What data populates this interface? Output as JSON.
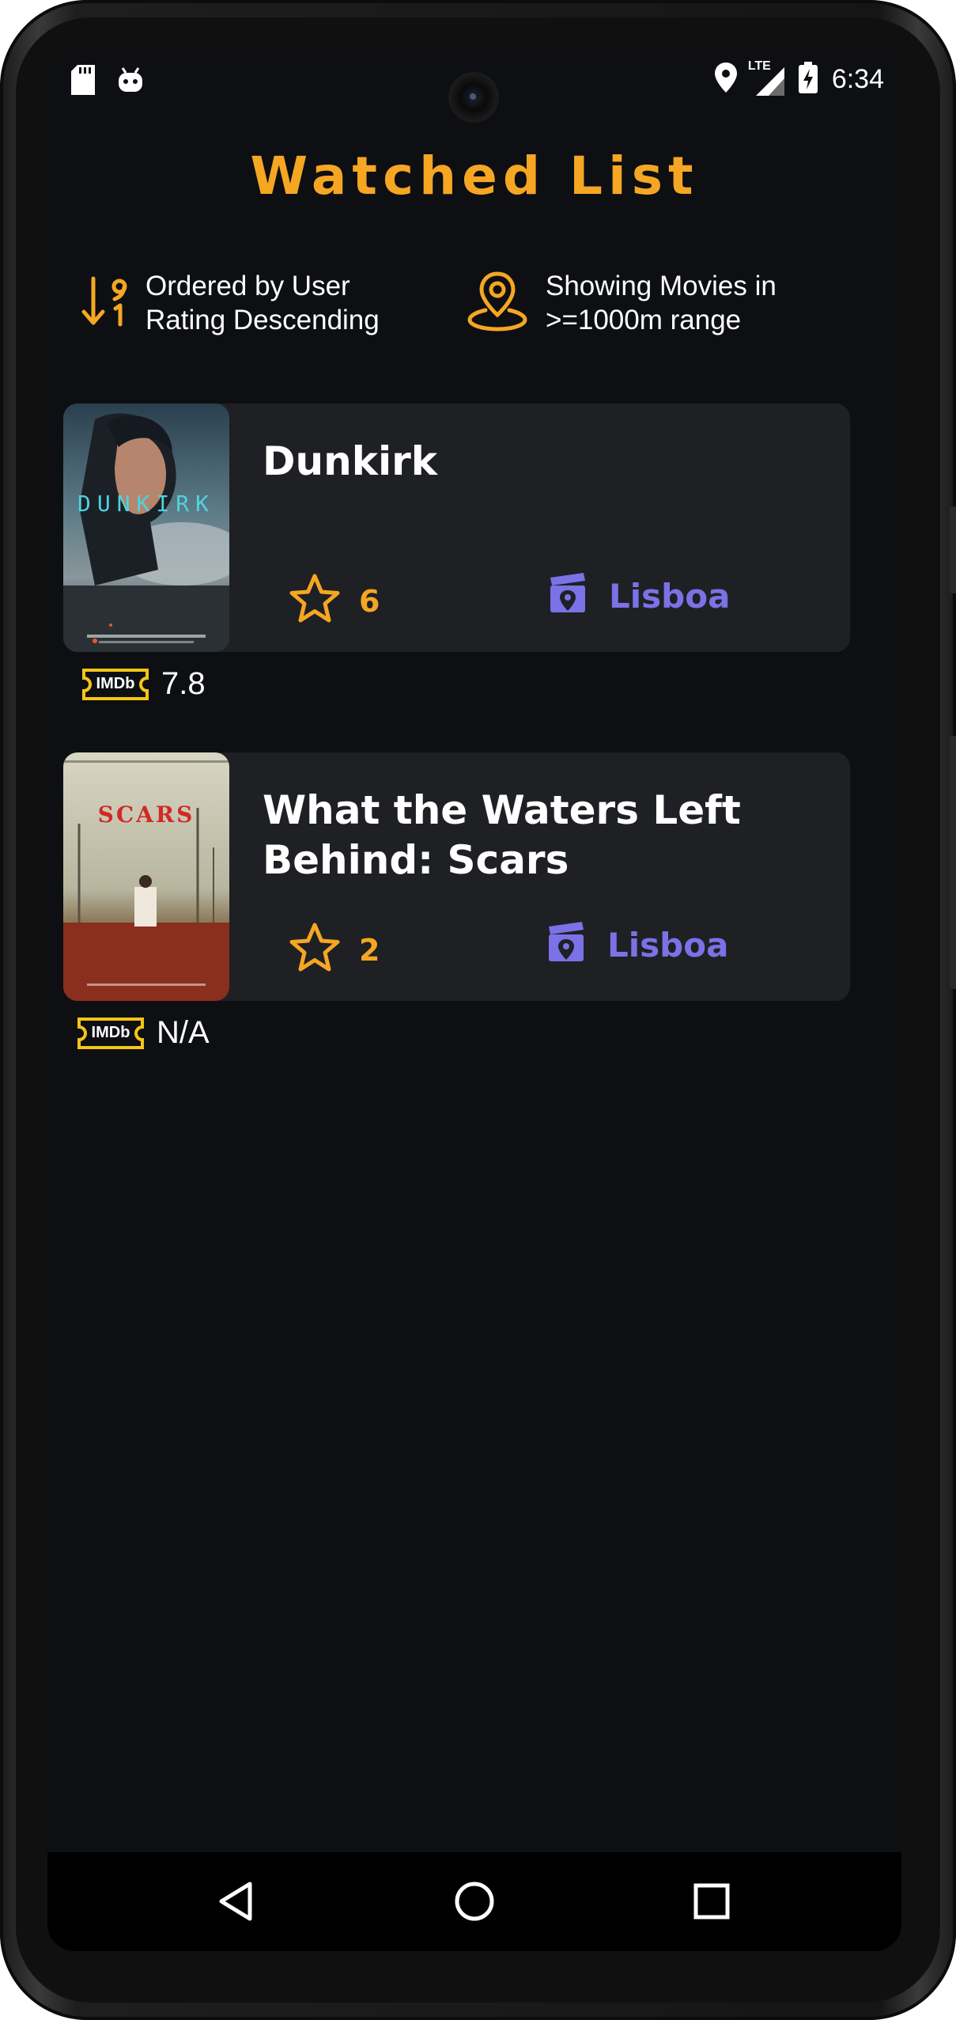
{
  "status_bar": {
    "time": "6:34",
    "icons": [
      "sd-card-icon",
      "android-icon",
      "location-icon",
      "lte-signal-icon",
      "battery-charging-icon"
    ],
    "network_label": "LTE"
  },
  "header": {
    "title": "Watched List"
  },
  "filters": {
    "order": {
      "icon": "sort-descending-icon",
      "text": "Ordered by User\nRating Descending"
    },
    "range": {
      "icon": "map-pin-icon",
      "text": "Showing Movies in\n>=1000m range"
    }
  },
  "movies": [
    {
      "title": "Dunkirk",
      "poster_text": "DUNKIRK",
      "user_rating": "6",
      "cinema": "Lisboa",
      "imdb_label": "IMDb",
      "imdb_rating": "7.8"
    },
    {
      "title": "What the Waters Left Behind: Scars",
      "poster_text": "SCARS",
      "user_rating": "2",
      "cinema": "Lisboa",
      "imdb_label": "IMDb",
      "imdb_rating": "N/A"
    }
  ],
  "nav": {
    "buttons": [
      "back-icon",
      "home-icon",
      "recents-icon"
    ]
  },
  "colors": {
    "accent": "#f5a623",
    "cinema": "#7a72e6",
    "card": "#1f2024",
    "background": "#0d0f12",
    "imdb": "#f5c518"
  }
}
